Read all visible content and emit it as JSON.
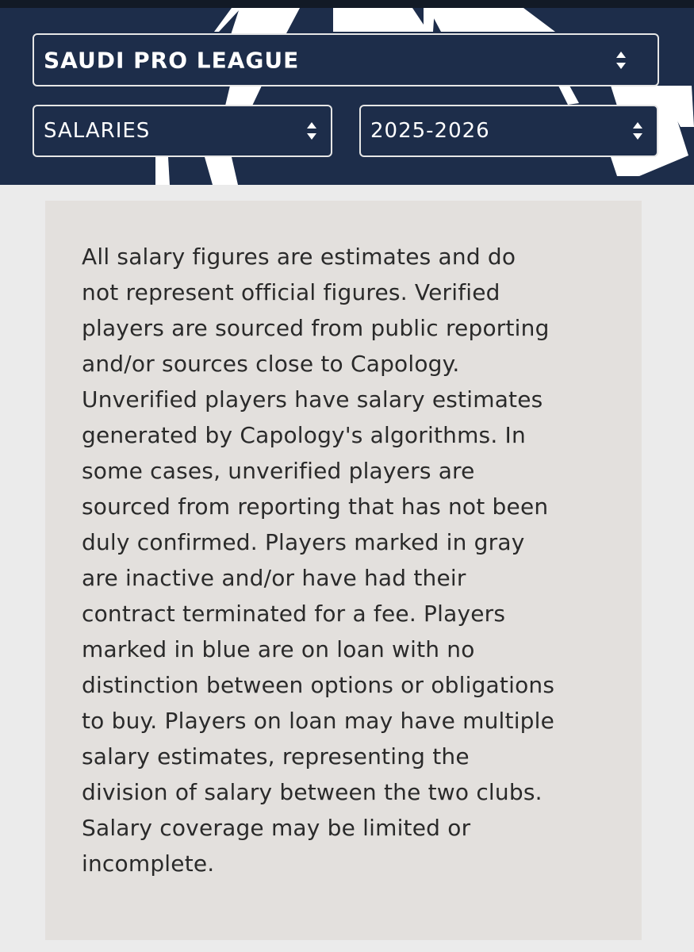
{
  "header": {
    "league_select": {
      "value": "SAUDI PRO LEAGUE"
    },
    "category_select": {
      "value": "SALARIES"
    },
    "season_select": {
      "value": "2025-2026"
    },
    "colors": {
      "background": "#1d2d4a",
      "border": "#e6e6e6",
      "graphic": "#ffffff"
    },
    "icons": {
      "select_arrows": "sort-arrows-icon"
    }
  },
  "notice": {
    "text": "All salary figures are estimates and do not represent official figures. Verified players are sourced from public reporting and/or sources close to Capology. Unverified players have salary estimates generated by Capology's algorithms. In some cases, unverified players are sourced from reporting that has not been duly confirmed. Players marked in gray are inactive and/or have had their contract terminated for a fee. Players marked in blue are on loan with no distinction between options or obligations to buy. Players on loan may have multiple salary estimates, representing the division of salary between the two clubs. Salary coverage may be limited or incomplete.",
    "colors": {
      "background": "#e3e0dd",
      "text": "#2a2a2a"
    }
  }
}
